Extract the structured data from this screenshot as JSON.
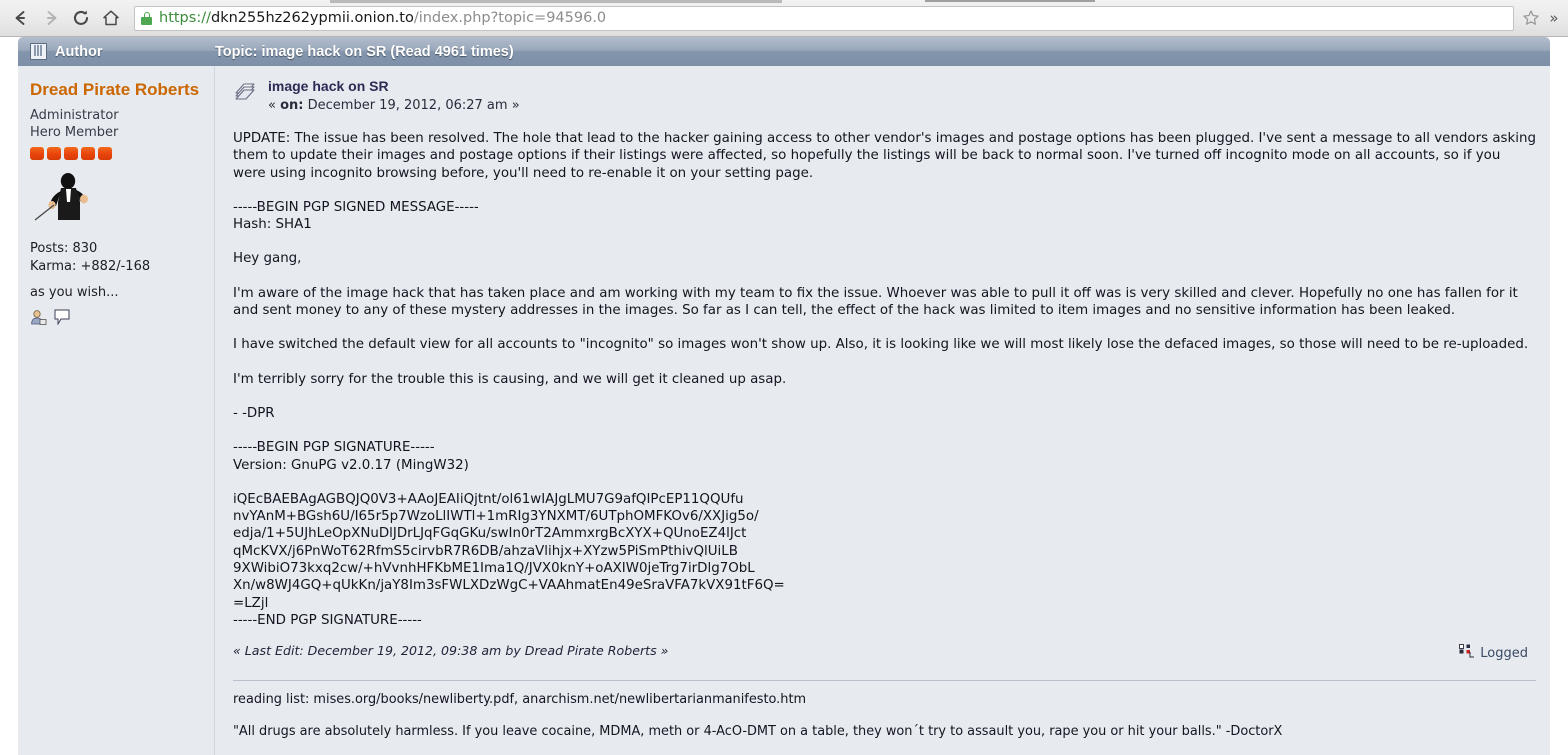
{
  "browser": {
    "back_icon": "back-arrow-icon",
    "forward_icon": "forward-arrow-icon",
    "reload_icon": "reload-icon",
    "home_icon": "home-icon",
    "lock_icon": "lock-icon",
    "url_scheme": "https://",
    "url_host": "dkn255hz262ypmii.onion.to",
    "url_path": "/index.php?topic=94596.0",
    "bookmark_icon": "star-icon",
    "overflow_label": "»"
  },
  "forum": {
    "header": {
      "author_column": "Author",
      "topic_column": "Topic: image hack on SR  (Read 4961 times)",
      "book_icon": "book-icon"
    },
    "author": {
      "name": "Dread Pirate Roberts",
      "group": "Administrator",
      "rank": "Hero Member",
      "stars": 5,
      "posts": "Posts: 830",
      "karma": "Karma: +882/-168",
      "tagline": "as you wish...",
      "icons": [
        "profile-icon",
        "message-icon"
      ]
    },
    "post": {
      "subject": "image hack on SR",
      "subject_icon": "post-topic-icon",
      "on_prefix": "«",
      "on_label": "on:",
      "on_date": "December 19, 2012, 06:27 am",
      "on_suffix": "»",
      "update_paragraph": "UPDATE:  The issue has been resolved.  The hole that lead to the hacker gaining access to other vendor's images and postage options has been plugged.  I've sent a message to all vendors asking them to update their images and postage options if their listings were affected, so hopefully the listings will be back to normal soon.  I've turned off incognito mode on all accounts, so if you were using incognito browsing before, you'll need to re-enable it on your setting page.",
      "pgp_begin": "-----BEGIN PGP SIGNED MESSAGE-----",
      "pgp_hash": "Hash: SHA1",
      "greeting": "Hey gang,",
      "para_aware": "I'm aware of the image hack that has taken place and am working with my team to fix the issue.  Whoever was able to pull it off was is very skilled and clever.  Hopefully no one has fallen for it and sent money to any of these mystery addresses in the images.  So far as I can tell, the effect of the hack was limited to item images and no sensitive information has been leaked.",
      "para_incognito": "I have switched the default view for all accounts to \"incognito\" so images won't show up.  Also, it is looking like we will most likely lose the defaced images, so those will need to be re-uploaded.",
      "para_sorry": "I'm terribly sorry for the trouble this is causing, and we will get it cleaned up asap.",
      "signoff": "- -DPR",
      "sig_begin": "-----BEGIN PGP SIGNATURE-----",
      "sig_version": "Version: GnuPG v2.0.17 (MingW32)",
      "sig_lines": [
        "iQEcBAEBAgAGBQJQ0V3+AAoJEAIiQjtnt/ol61wIAJgLMU7G9afQIPcEP11QQUfu",
        "nvYAnM+BGsh6U/I65r5p7WzoLlIWTl+1mRIg3YNXMT/6UTphOMFKOv6/XXJig5o/",
        "edja/1+5UJhLeOpXNuDlJDrLJqFGqGKu/swIn0rT2AmmxrgBcXYX+QUnoEZ4lJct",
        "qMcKVX/j6PnWoT62RfmS5cirvbR7R6DB/ahzaVlihjx+XYzw5PiSmPthivQlUiLB",
        "9XWibiO73kxq2cw/+hVvnhHFKbME1Ima1Q/JVX0knY+oAXIW0jeTrg7irDlg7ObL",
        "Xn/w8WJ4GQ+qUkKn/jaY8Im3sFWLXDzWgC+VAAhmatEn49eSraVFA7kVX91tF6Q=",
        "=LZjl"
      ],
      "sig_end": "-----END PGP SIGNATURE-----",
      "last_edit": "« Last Edit: December 19, 2012, 09:38 am by Dread Pirate Roberts »",
      "logged_label": "Logged",
      "logged_icon": "logged-tree-icon",
      "signature_line1": "reading list: mises.org/books/newliberty.pdf, anarchism.net/newlibertarianmanifesto.htm",
      "signature_line2": "\"All drugs are absolutely harmless. If you leave cocaine, MDMA, meth or 4-AcO-DMT on a table, they won´t try to assault you, rape you or hit your balls.\"  -DoctorX"
    }
  },
  "colors": {
    "author_name": "#cc6600",
    "header_bar": "#8496ad",
    "post_bg": "#e7ebef",
    "star_pip": "#e8440b",
    "lock_green": "#4fa84f"
  }
}
